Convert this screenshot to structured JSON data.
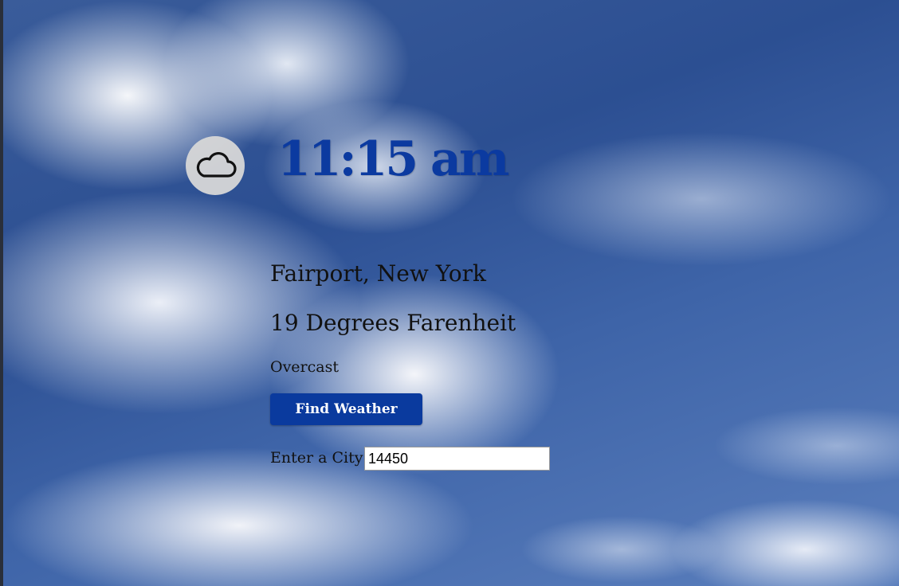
{
  "weather": {
    "icon": "cloud-icon",
    "time": "11:15 am",
    "location": "Fairport, New York",
    "temperature": "19 Degrees Farenheit",
    "condition": "Overcast"
  },
  "search": {
    "button_label": "Find Weather",
    "city_label": "Enter a City",
    "city_value": "14450"
  },
  "colors": {
    "accent": "#0a3a9e",
    "time_text": "#0b3aa0"
  }
}
